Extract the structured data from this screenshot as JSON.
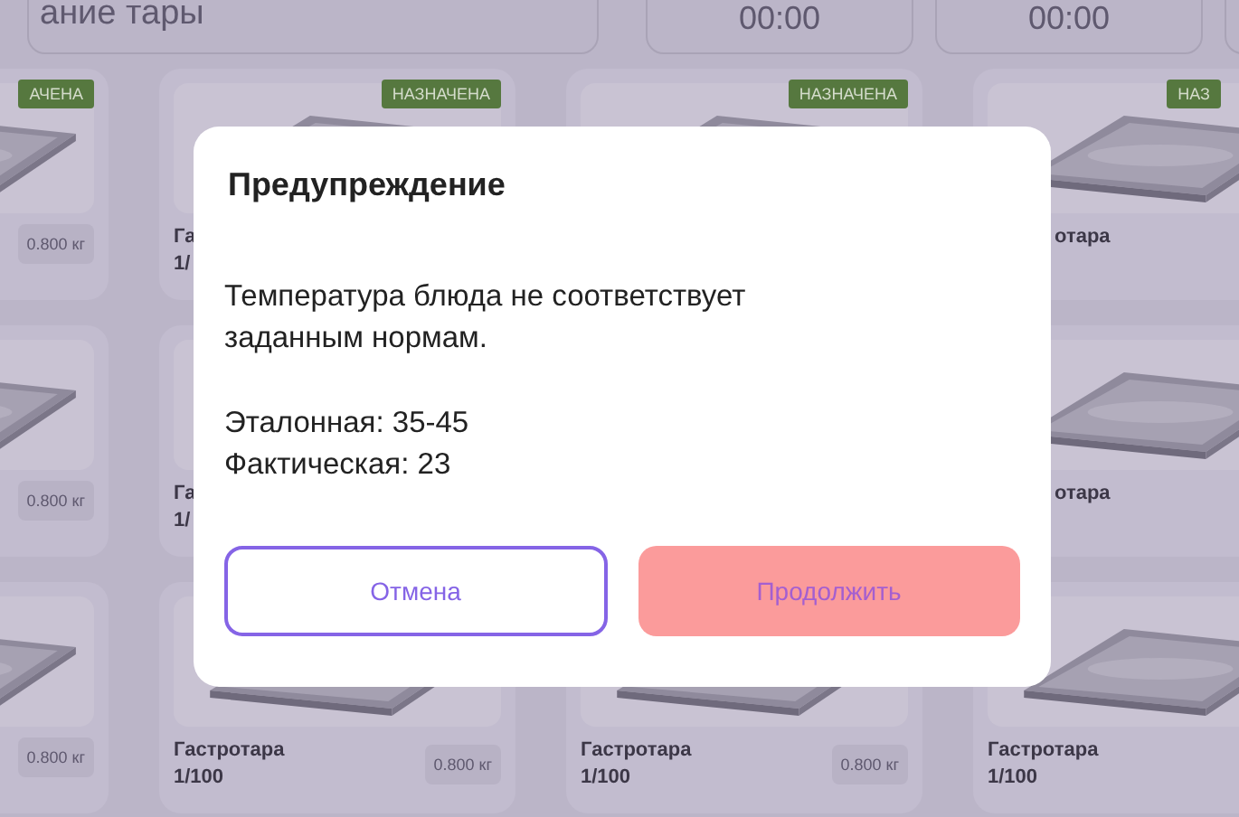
{
  "search": {
    "value": "ание тары"
  },
  "times": [
    "00:00",
    "00:00"
  ],
  "cards": [
    {
      "badge": "АЧЕНА",
      "weight": "0.800 кг"
    },
    {
      "badge": "НАЗНАЧЕНА",
      "name": "Га",
      "size": "1/"
    },
    {
      "badge": "НАЗНАЧЕНА"
    },
    {
      "badge": "НАЗ",
      "name": "отара"
    },
    {
      "weight": "0.800 кг"
    },
    {
      "name": "Га",
      "size": "1/"
    },
    {
      "name": "отара"
    },
    {
      "weight": "0.800 кг"
    },
    {
      "name": "Гастротара",
      "size": "1/100",
      "weight": "0.800 кг"
    },
    {
      "name": "Гастротара",
      "size": "1/100",
      "weight": "0.800 кг"
    },
    {
      "name": "Гастротара",
      "size": "1/100"
    }
  ],
  "dialog": {
    "title": "Предупреждение",
    "message": "Температура блюда не соответствует заданным нормам.",
    "details": [
      "Эталонная: 35-45",
      "Фактическая: 23"
    ],
    "buttons": [
      {
        "label": "Отмена",
        "kind": "outline"
      },
      {
        "label": "Продолжить",
        "kind": "filled"
      }
    ]
  }
}
